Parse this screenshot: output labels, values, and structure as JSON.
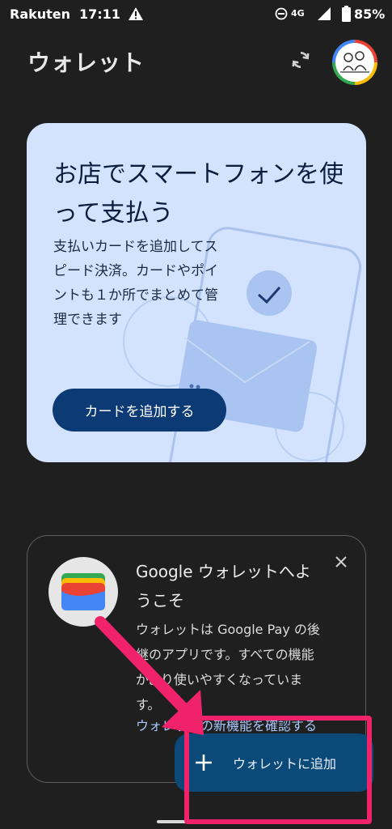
{
  "status_bar": {
    "carrier": "Rakuten",
    "time": "17:11",
    "network": "4G",
    "battery": "85%"
  },
  "header": {
    "title": "ウォレット"
  },
  "promo": {
    "title": "お店でスマートフォンを使って支払う",
    "description": "支払いカードを追加してスピード決済。カードやポイントも１か所でまとめて管理できます",
    "button_label": "カードを追加する"
  },
  "welcome": {
    "title": "Google ウォレットへようこそ",
    "body": "ウォレットは Google Pay の後継のアプリです。すべての機能がより使いやすくなっています。",
    "link": "ウォレットの新機能を確認する"
  },
  "fab": {
    "label": "ウォレットに追加"
  },
  "colors": {
    "background": "#1f1f1f",
    "promo_card": "#d3e3fd",
    "primary_button": "#0b3a75",
    "fab": "#0b4a78",
    "link": "#a8c7fa",
    "annotation": "#f0236a"
  },
  "icons": [
    "warning-icon",
    "dnd-icon",
    "signal-icon",
    "battery-icon",
    "sync-icon",
    "avatar",
    "wallet-icon",
    "close-icon",
    "plus-icon"
  ]
}
